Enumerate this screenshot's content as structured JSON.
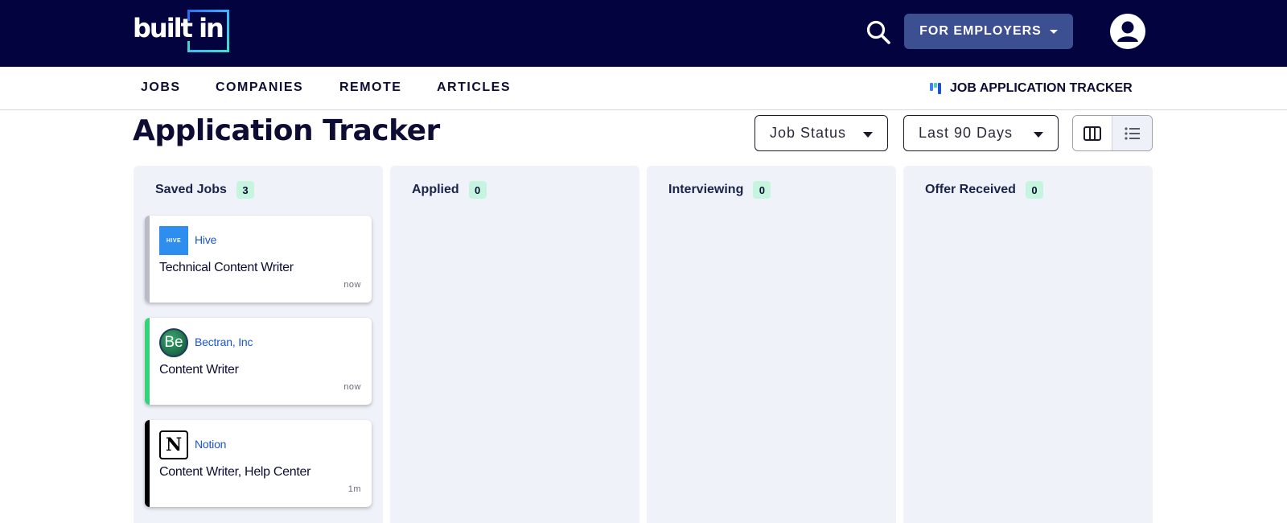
{
  "header": {
    "logo_text": "built in",
    "employers_label": "FOR EMPLOYERS",
    "colors": {
      "background": "#03033f",
      "employers_button": "#3c4f91"
    }
  },
  "nav": {
    "items": [
      {
        "label": "JOBS"
      },
      {
        "label": "COMPANIES"
      },
      {
        "label": "REMOTE"
      },
      {
        "label": "ARTICLES"
      }
    ],
    "tracker_label": "JOB APPLICATION TRACKER"
  },
  "page": {
    "title": "Application Tracker",
    "filters": {
      "status_label": "Job Status",
      "range_label": "Last 90 Days"
    }
  },
  "board": {
    "columns": [
      {
        "name": "Saved Jobs",
        "count": "3"
      },
      {
        "name": "Applied",
        "count": "0"
      },
      {
        "name": "Interviewing",
        "count": "0"
      },
      {
        "name": "Offer Received",
        "count": "0"
      }
    ],
    "saved_jobs": [
      {
        "company": "Hive",
        "title": "Technical Content Writer",
        "time": "now",
        "logo_text": "HIVE",
        "stripe_color": "#b9bcc6"
      },
      {
        "company": "Bectran, Inc",
        "title": "Content Writer",
        "time": "now",
        "logo_text": "Be",
        "stripe_color": "#34d27a"
      },
      {
        "company": "Notion",
        "title": "Content Writer, Help Center",
        "time": "1m",
        "logo_text": "N",
        "stripe_color": "#000000"
      }
    ],
    "colors": {
      "badge": "#c6f5df",
      "column_bg": "#eff2f9",
      "company_link": "#1a55c9"
    }
  }
}
